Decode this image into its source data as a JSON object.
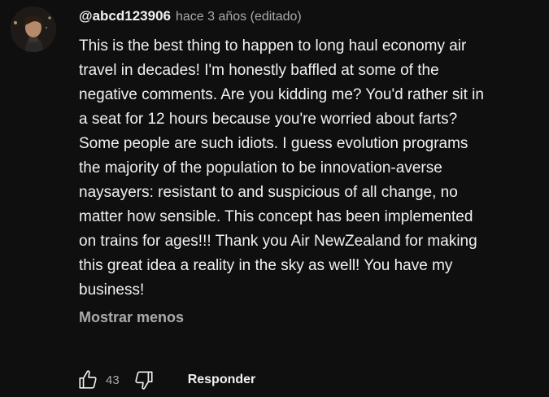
{
  "comment": {
    "author": "@abcd123906",
    "timestamp": "hace 3 años (editado)",
    "text": "This is the best thing to happen to long haul economy air travel in decades! I'm honestly baffled at some of the negative comments. Are you kidding me? You'd rather sit in a seat for 12 hours because you're worried about farts? Some people are such idiots. I guess evolution programs the majority of the population to be innovation-averse naysayers: resistant to and suspicious of all change, no matter how sensible. This concept has been implemented on trains for ages!!! Thank you Air NewZealand for making this great idea a reality in the sky as well! You have my business!",
    "show_less_label": "Mostrar menos",
    "like_count": "43",
    "reply_label": "Responder"
  },
  "icons": {
    "like": "thumbs-up-outline-icon",
    "dislike": "thumbs-down-outline-icon"
  },
  "colors": {
    "background": "#0f0f0f",
    "primary_text": "#f1f1f1",
    "secondary_text": "#aaaaaa"
  }
}
